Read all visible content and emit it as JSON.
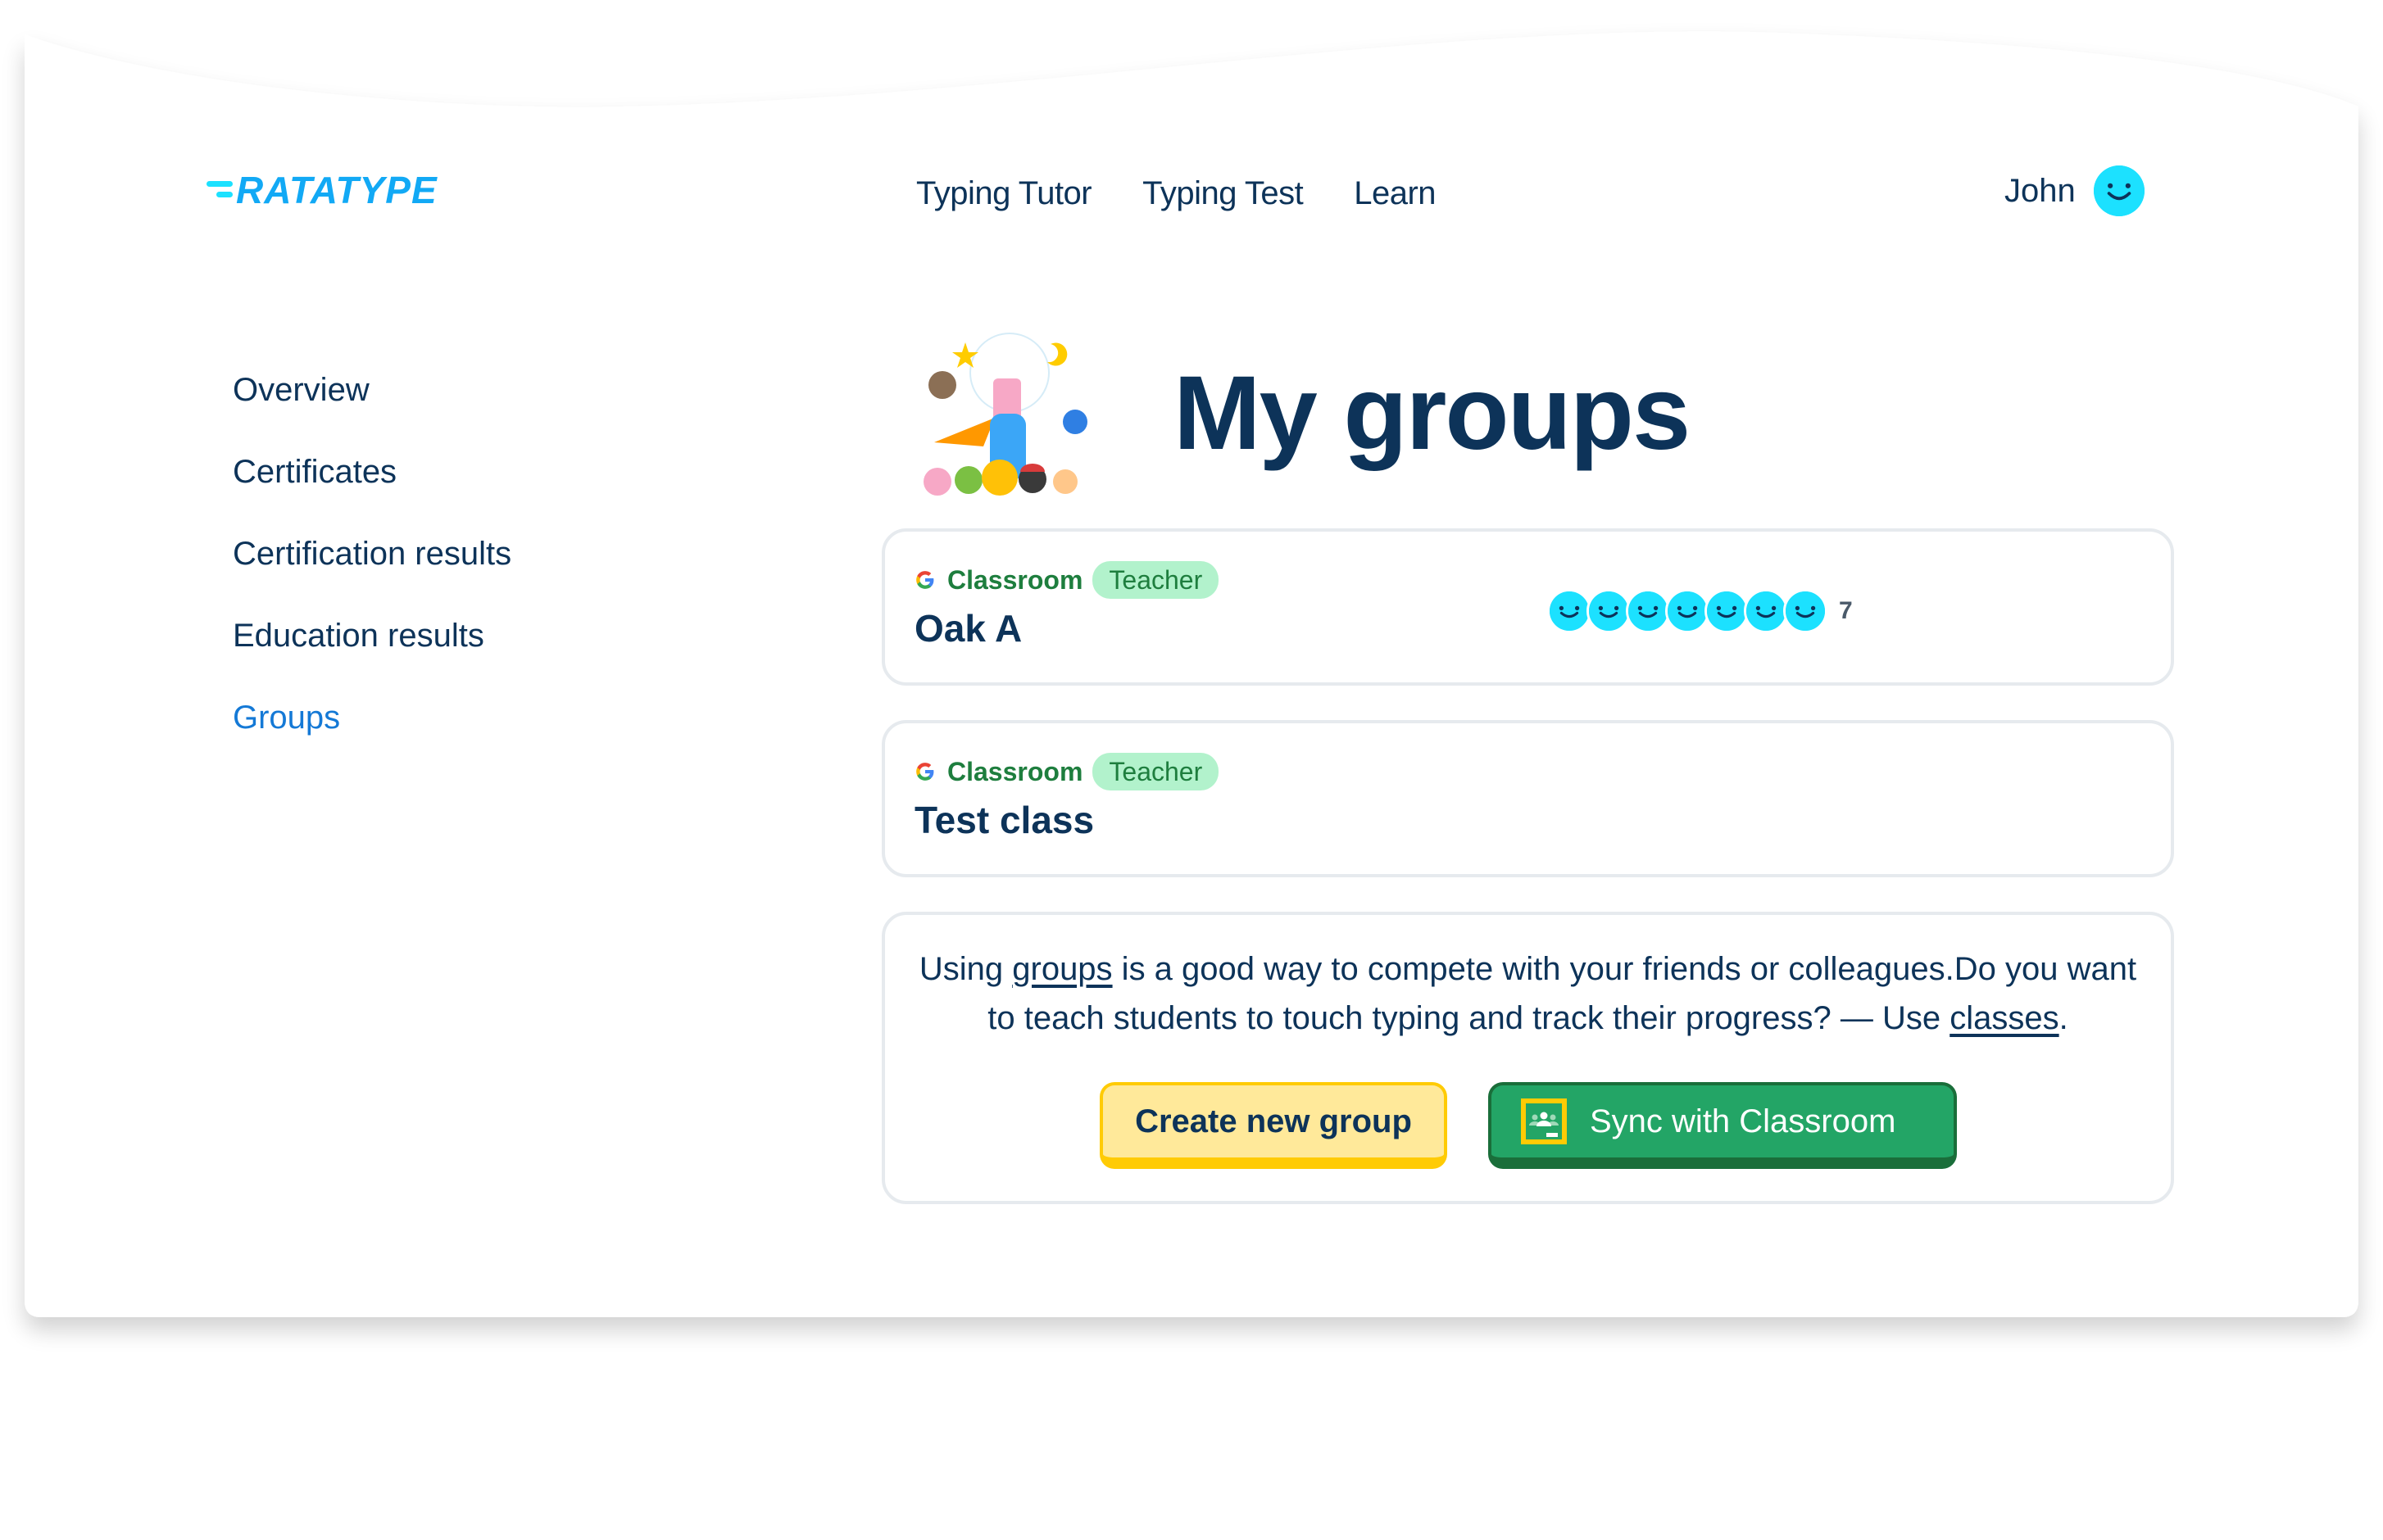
{
  "brand": {
    "logo_text": "RATATYPE",
    "logo_color": "#12a9f5"
  },
  "topnav": {
    "items": [
      {
        "label": "Typing Tutor"
      },
      {
        "label": "Typing Test"
      },
      {
        "label": "Learn"
      }
    ]
  },
  "user": {
    "name": "John",
    "avatar_icon": "smiley-avatar-icon",
    "avatar_color": "#1ce1ff"
  },
  "sidebar": {
    "items": [
      {
        "label": "Overview",
        "active": false
      },
      {
        "label": "Certificates",
        "active": false
      },
      {
        "label": "Certification results",
        "active": false
      },
      {
        "label": "Education results",
        "active": false
      },
      {
        "label": "Groups",
        "active": true
      }
    ]
  },
  "main": {
    "title": "My groups",
    "hero_icon": "mascot-characters-illustration",
    "groups": [
      {
        "source_icon": "google-g-icon",
        "source_label": "Classroom",
        "role_badge": "Teacher",
        "name": "Oak A",
        "member_avatars": 7,
        "member_count": "7"
      },
      {
        "source_icon": "google-g-icon",
        "source_label": "Classroom",
        "role_badge": "Teacher",
        "name": "Test class"
      }
    ],
    "info": {
      "text_before": "Using ",
      "groups_link": "groups",
      "text_middle": " is a good way to compete with your friends or colleagues.Do you want to teach students to touch typing and track their progress? — Use ",
      "classes_link": "classes",
      "text_after": "."
    },
    "buttons": {
      "create_group": "Create new group",
      "sync_classroom": "Sync with Classroom",
      "sync_icon": "google-classroom-icon"
    }
  },
  "colors": {
    "text_primary": "#0d3359",
    "active_link": "#1479d6",
    "classroom_green": "#1e7e3e",
    "badge_bg": "#b2f2cc",
    "button_yellow": "#ffe99a",
    "button_yellow_border": "#ffcb05",
    "button_green": "#23a566",
    "button_green_border": "#1a6e3a"
  }
}
